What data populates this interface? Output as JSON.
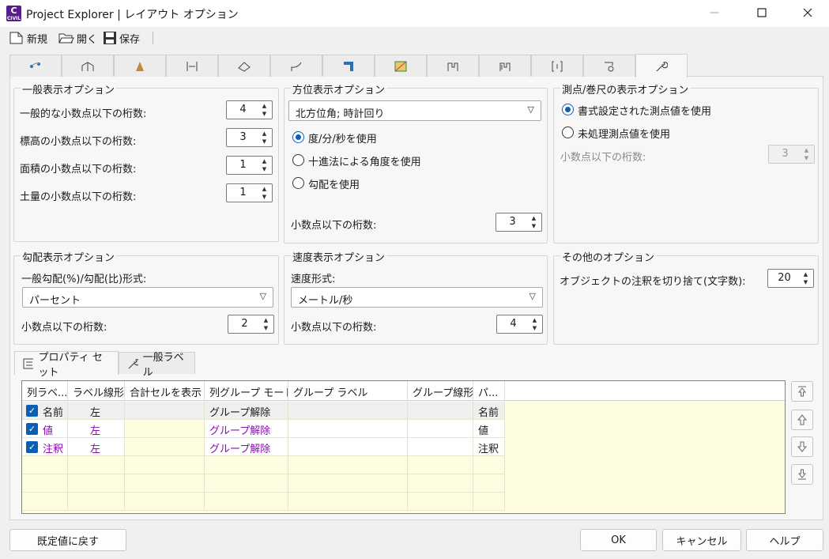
{
  "window": {
    "title": "Project Explorer | レイアウト オプション",
    "app_icon_letter": "C",
    "app_icon_sub": "CIVIL"
  },
  "toolbar": {
    "new_label": "新規",
    "open_label": "開く",
    "save_label": "保存"
  },
  "general": {
    "title": "一般表示オプション",
    "rows": [
      {
        "label": "一般的な小数点以下の桁数:",
        "value": "4"
      },
      {
        "label": "標高の小数点以下の桁数:",
        "value": "3"
      },
      {
        "label": "面積の小数点以下の桁数:",
        "value": "1"
      },
      {
        "label": "土量の小数点以下の桁数:",
        "value": "1"
      }
    ]
  },
  "direction": {
    "title": "方位表示オプション",
    "combo": "北方位角; 時計回り",
    "radios": [
      "度/分/秒を使用",
      "十進法による角度を使用",
      "勾配を使用"
    ],
    "selected": 0,
    "precision_label": "小数点以下の桁数:",
    "precision_value": "3"
  },
  "station": {
    "title": "測点/巻尺の表示オプション",
    "radios": [
      "書式設定された測点値を使用",
      "未処理測点値を使用"
    ],
    "selected": 0,
    "precision_label": "小数点以下の桁数:",
    "precision_value": "3"
  },
  "grade": {
    "title": "勾配表示オプション",
    "format_label": "一般勾配(%)/勾配(比)形式:",
    "combo": "パーセント",
    "precision_label": "小数点以下の桁数:",
    "precision_value": "2"
  },
  "speed": {
    "title": "速度表示オプション",
    "format_label": "速度形式:",
    "combo": "メートル/秒",
    "precision_label": "小数点以下の桁数:",
    "precision_value": "4"
  },
  "other": {
    "title": "その他のオプション",
    "label": "オブジェクトの注釈を切り捨て(文字数):",
    "value": "20"
  },
  "bottom_tabs": [
    {
      "label": "プロパティ セット"
    },
    {
      "label": "一般ラベル"
    }
  ],
  "grid": {
    "headers": [
      "列ラベ...",
      "ラベル線形",
      "合計セルを表示",
      "列グループ モード",
      "グループ ラベル",
      "グループ線形",
      "パ..."
    ],
    "rows": [
      {
        "label": "名前",
        "align": "左",
        "mode": "グループ解除",
        "prop": "名前"
      },
      {
        "label": "値",
        "align": "左",
        "mode": "グループ解除",
        "prop": "値"
      },
      {
        "label": "注釈",
        "align": "左",
        "mode": "グループ解除",
        "prop": "注釈"
      }
    ]
  },
  "buttons": {
    "reset": "既定値に戻す",
    "ok": "OK",
    "cancel": "キャンセル",
    "help": "ヘルプ"
  },
  "colors": {
    "accent": "#0a5fb4",
    "highlight_text": "#8a0ab0",
    "grid_bg": "#fffde0"
  }
}
